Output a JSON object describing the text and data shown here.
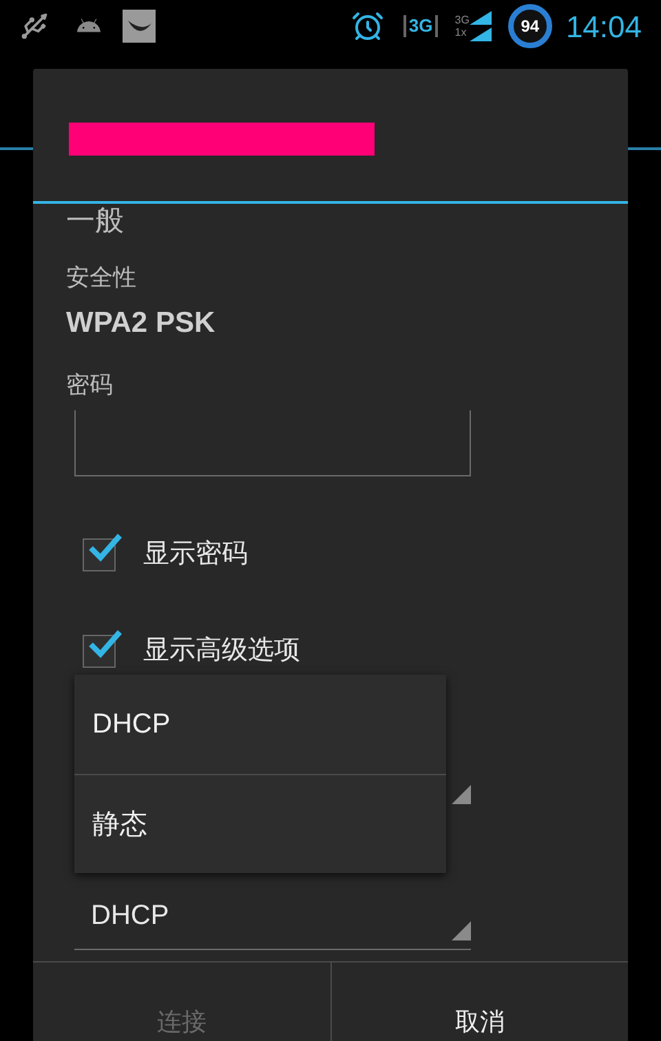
{
  "status_bar": {
    "data_label": "3G",
    "signal_labels": [
      "3G",
      "1x"
    ],
    "battery": "94",
    "time": "14:04"
  },
  "dialog": {
    "section": "一般",
    "fields": [
      {
        "kind": "info",
        "label": "安全性",
        "value": "WPA2 PSK"
      },
      {
        "kind": "password",
        "label": "密码"
      }
    ],
    "checkboxes": [
      {
        "label": "显示密码",
        "checked": true
      },
      {
        "label": "显示高级选项",
        "checked": true
      }
    ],
    "spinners": [
      {
        "open": true,
        "options": [
          {
            "label": "DHCP"
          },
          {
            "label": "静态"
          }
        ]
      },
      {
        "open": false,
        "value": "DHCP"
      }
    ],
    "buttons": [
      {
        "label": "连接",
        "disabled": true
      },
      {
        "label": "取消",
        "disabled": false
      }
    ]
  }
}
